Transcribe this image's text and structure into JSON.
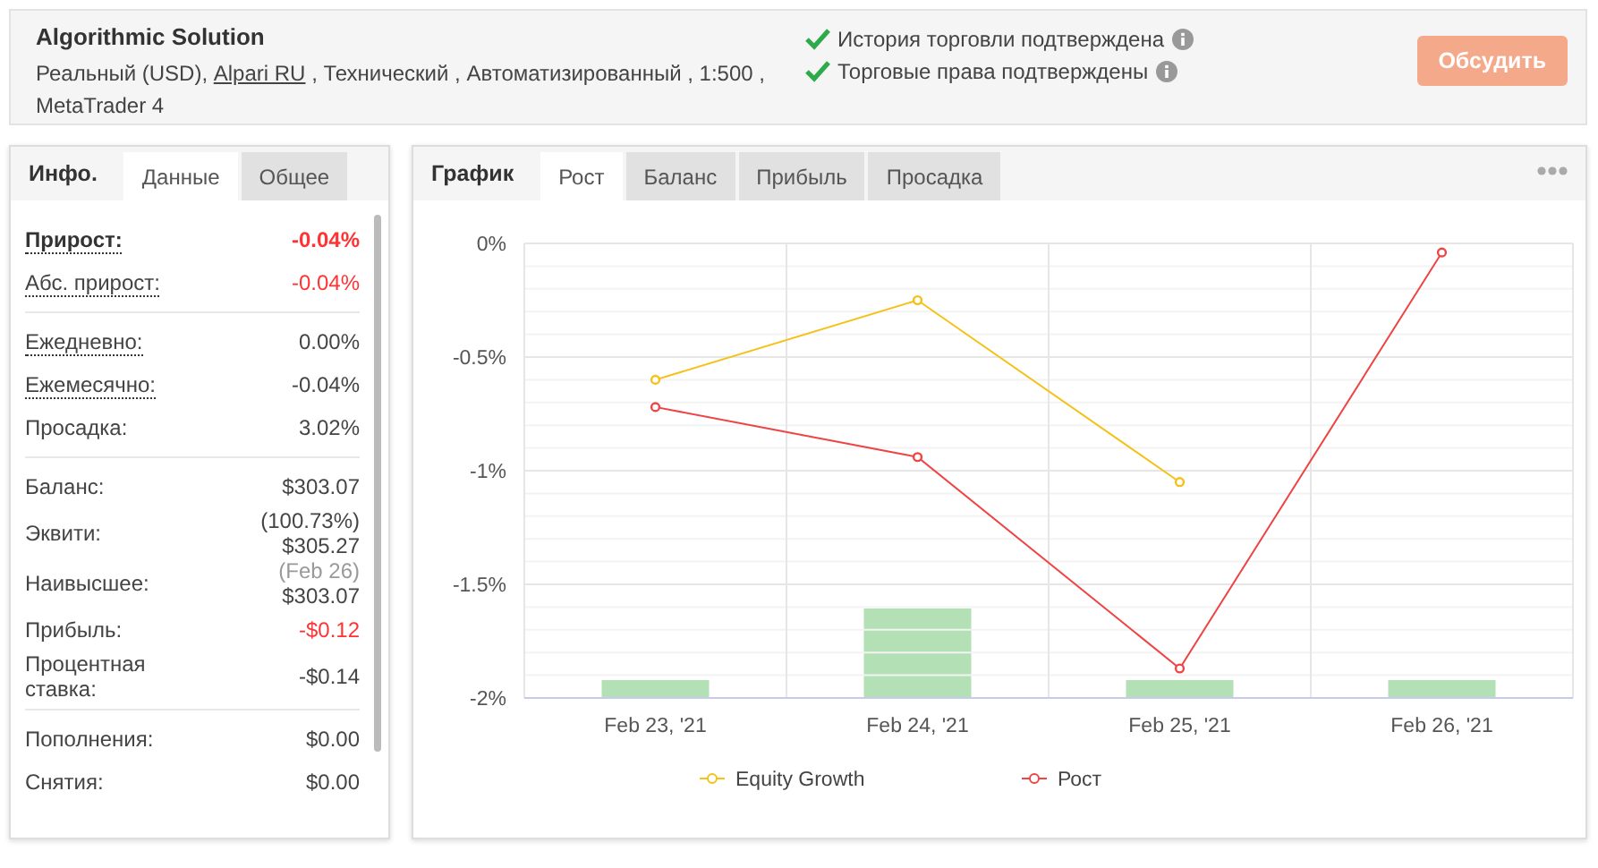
{
  "header": {
    "title": "Algorithmic Solution",
    "details": {
      "prefix": "Реальный (USD),",
      "link": "Alpari RU",
      "suffix": ", Технический , Автоматизированный , 1:500 , MetaTrader 4"
    },
    "checks": [
      {
        "text": "История торговли подтверждена",
        "verified": true
      },
      {
        "text": "Торговые права подтверждены",
        "verified": true
      }
    ],
    "button": "Обсудить"
  },
  "info_panel": {
    "heading": "Инфо.",
    "tabs": [
      {
        "label": "Данные",
        "selected": true
      },
      {
        "label": "Общее",
        "selected": false
      }
    ],
    "groups": [
      [
        {
          "label": "Прирост:",
          "value": "-0.04%",
          "hint": true,
          "bold": true,
          "highlight": true
        },
        {
          "label": "Абс. прирост:",
          "value": "-0.04%",
          "hint": true,
          "bold": false,
          "highlight": true
        }
      ],
      [
        {
          "label": "Ежедневно:",
          "value": "0.00%",
          "hint": true,
          "bold": false,
          "highlight": false
        },
        {
          "label": "Ежемесячно:",
          "value": "-0.04%",
          "hint": true,
          "bold": false,
          "highlight": false
        },
        {
          "label": "Просадка:",
          "value": "3.02%",
          "hint": false,
          "bold": false,
          "highlight": false
        }
      ],
      [
        {
          "label": "Баланс:",
          "value": "$303.07",
          "hint": false,
          "bold": false,
          "highlight": false
        },
        {
          "label": "Эквити:",
          "note": "(100.73%)",
          "note_muted": false,
          "value": "$305.27",
          "hint": false,
          "bold": false,
          "highlight": false
        },
        {
          "label": "Наивысшее:",
          "note": "(Feb 26)",
          "note_muted": true,
          "value": "$303.07",
          "hint": false,
          "bold": false,
          "highlight": false
        },
        {
          "label": "Прибыль:",
          "value": "-$0.12",
          "hint": false,
          "bold": false,
          "highlight": true
        },
        {
          "label": "Процентная ставка:",
          "value": "-$0.14",
          "hint": false,
          "bold": false,
          "highlight": false
        }
      ],
      [
        {
          "label": "Пополнения:",
          "value": "$0.00",
          "hint": false,
          "bold": false,
          "highlight": false
        },
        {
          "label": "Снятия:",
          "value": "$0.00",
          "hint": false,
          "bold": false,
          "highlight": false
        }
      ]
    ]
  },
  "chart_panel": {
    "heading": "График",
    "tabs": [
      {
        "label": "Рост",
        "selected": true
      },
      {
        "label": "Баланс",
        "selected": false
      },
      {
        "label": "Прибыль",
        "selected": false
      },
      {
        "label": "Просадка",
        "selected": false
      }
    ],
    "chart_data": {
      "type": "line",
      "categories": [
        "Feb 23, '21",
        "Feb 24, '21",
        "Feb 25, '21",
        "Feb 26, '21"
      ],
      "ylim": [
        -2,
        0
      ],
      "yticks": [
        {
          "value": 0,
          "label": "0%"
        },
        {
          "value": -0.5,
          "label": "-0.5%"
        },
        {
          "value": -1,
          "label": "-1%"
        },
        {
          "value": -1.5,
          "label": "-1.5%"
        },
        {
          "value": -2,
          "label": "-2%"
        }
      ],
      "grid": true,
      "legend": true,
      "series": [
        {
          "name": "Equity Growth",
          "color": "#f5c116",
          "marker": "circle",
          "values": [
            -0.6,
            -0.25,
            -1.05,
            null
          ]
        },
        {
          "name": "Рост",
          "color": "#ee4444",
          "marker": "circle",
          "values": [
            -0.72,
            -0.94,
            -1.87,
            -0.04
          ]
        }
      ]
    }
  }
}
